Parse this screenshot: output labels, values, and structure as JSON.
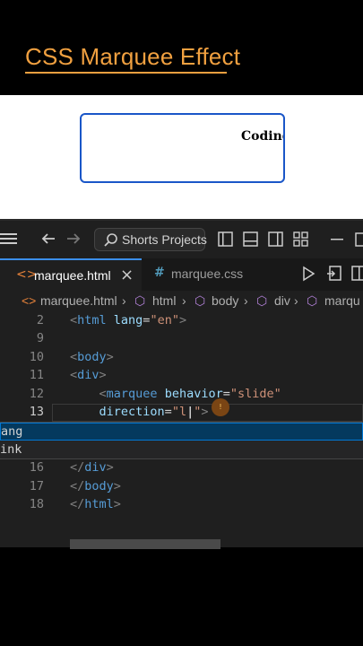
{
  "title": "CSS Marquee Effect",
  "preview": {
    "marquee_text": "Coding"
  },
  "titlebar": {
    "search_label": "Shorts Projects",
    "icons": [
      "menu-icon",
      "back-arrow-icon",
      "forward-arrow-icon",
      "search-icon",
      "toggle-sidebar-icon",
      "toggle-panel-icon",
      "toggle-secondary-sidebar-icon",
      "customize-layout-icon",
      "minimize-icon"
    ]
  },
  "tabs": [
    {
      "label": "marquee.html",
      "icon": "html-file-icon",
      "active": true,
      "close": "×"
    },
    {
      "label": "marquee.css",
      "icon": "css-file-icon",
      "active": false
    }
  ],
  "breadcrumb": [
    "marquee.html",
    "html",
    "body",
    "div",
    "marqu"
  ],
  "code_lines": [
    {
      "num": "2",
      "open": "<",
      "tag": "html",
      "attr": " lang",
      "eq": "=",
      "str": "\"en\"",
      "close": ">"
    },
    {
      "num": "9"
    },
    {
      "num": "10",
      "open": "<",
      "tag": "body",
      "close": ">"
    },
    {
      "num": "11",
      "open": "<",
      "tag": "div",
      "close": ">"
    },
    {
      "num": "12",
      "indent": "    ",
      "open": "<",
      "tag": "marquee",
      "attr": " behavior",
      "eq": "=",
      "str": "\"slide\""
    },
    {
      "num": "13",
      "indent": "    ",
      "attr": "direction",
      "eq": "=",
      "str": "\"l",
      "cursor": "|",
      "str2": "\"",
      "close": ">"
    },
    {
      "num": "16",
      "open": "</",
      "tag": "div",
      "close": ">"
    },
    {
      "num": "17",
      "open": "</",
      "tag": "body",
      "close": ">"
    },
    {
      "num": "18",
      "open": "</",
      "tag": "html",
      "close": ">"
    }
  ],
  "suggestions": [
    "ang",
    "ink"
  ],
  "lightbulb": "!"
}
